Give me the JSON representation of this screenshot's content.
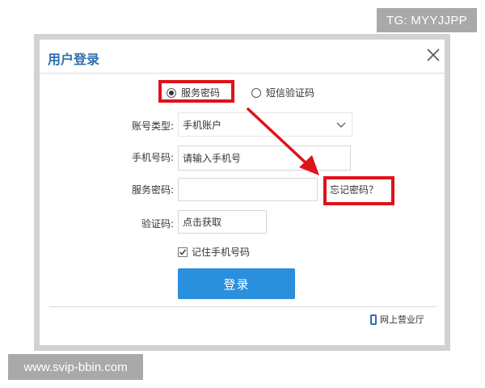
{
  "overlay": {
    "top_badge": "TG: MYYJJPP",
    "bottom_badge": "www.svip-bbin.com"
  },
  "dialog": {
    "title": "用户登录",
    "close_icon": "close-icon",
    "login_modes": [
      {
        "label": "服务密码",
        "selected": true
      },
      {
        "label": "短信验证码",
        "selected": false
      }
    ],
    "fields": {
      "account_type": {
        "label": "账号类型:",
        "value": "手机账户"
      },
      "phone": {
        "label": "手机号码:",
        "placeholder": "请输入手机号"
      },
      "password": {
        "label": "服务密码:",
        "value": ""
      },
      "verify_code": {
        "label": "验证码:",
        "placeholder": "点击获取"
      }
    },
    "forgot_password": "忘记密码？",
    "remember": {
      "label": "记住手机号码",
      "checked": true
    },
    "login_button": "登录",
    "hall_link": "网上营业厅"
  },
  "colors": {
    "title": "#2f6fb0",
    "button": "#2a8fdd",
    "highlight": "#e0121a",
    "arrow": "#e0121a"
  }
}
